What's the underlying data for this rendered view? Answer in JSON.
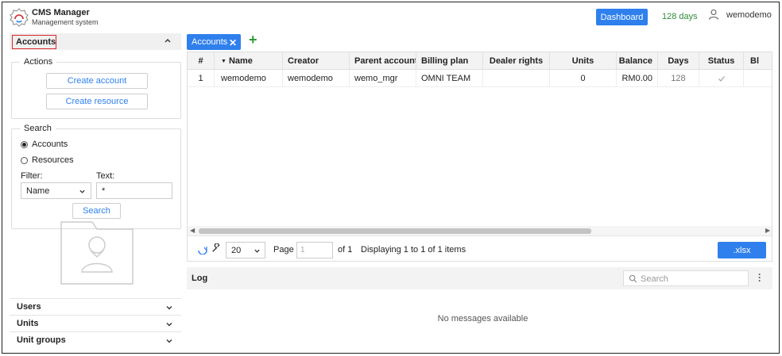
{
  "header": {
    "app_title": "CMS Manager",
    "app_subtitle": "Management system",
    "dashboard_label": "Dashboard",
    "days_left": "128 days",
    "user_name": "wemodemo",
    "days_color": "#2e8b3a",
    "accent": "#2f80ed"
  },
  "sidebar": {
    "accounts_label": "Accounts",
    "actions": {
      "legend": "Actions",
      "create_account": "Create account",
      "create_resource": "Create resource"
    },
    "search": {
      "legend": "Search",
      "radio_accounts": "Accounts",
      "radio_resources": "Resources",
      "selected": "Accounts",
      "filter_label": "Filter:",
      "text_label": "Text:",
      "filter_value": "Name",
      "text_value": "*",
      "search_button": "Search"
    },
    "sections": [
      {
        "label": "Users"
      },
      {
        "label": "Units"
      },
      {
        "label": "Unit groups"
      }
    ]
  },
  "tabs": [
    {
      "label": "Accounts",
      "active": true
    }
  ],
  "grid": {
    "columns": [
      "#",
      "Name",
      "Creator",
      "Parent account",
      "Billing plan",
      "Dealer rights",
      "Units",
      "Balance",
      "Days",
      "Status",
      "Bl"
    ],
    "sort_column": "Name",
    "rows": [
      {
        "num": "1",
        "name": "wemodemo",
        "creator": "wemodemo",
        "parent": "wemo_mgr",
        "plan": "OMNI TEAM",
        "dealer": "",
        "units": "0",
        "balance": "RM0.00",
        "days": "128",
        "status": "check-icon",
        "bl": ""
      }
    ]
  },
  "pager": {
    "page_size": "20",
    "page_label": "Page",
    "page_value": "1",
    "of_label": "of 1",
    "displaying": "Displaying 1 to 1 of 1 items",
    "export_label": ".xlsx"
  },
  "log": {
    "title": "Log",
    "search_placeholder": "Search",
    "empty_message": "No messages available"
  }
}
